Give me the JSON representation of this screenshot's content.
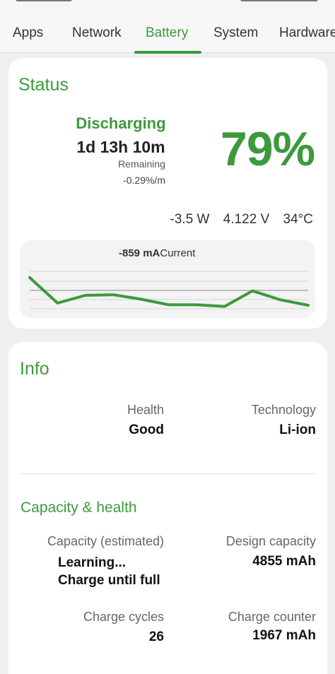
{
  "tabs": [
    {
      "label": "Apps"
    },
    {
      "label": "Network"
    },
    {
      "label": "Battery"
    },
    {
      "label": "System"
    },
    {
      "label": "Hardware"
    }
  ],
  "active_tab": "Battery",
  "status": {
    "title": "Status",
    "state": "Discharging",
    "remaining_time": "1d 13h 10m",
    "remaining_label": "Remaining",
    "rate": "-0.29%/m",
    "percent": "79%",
    "power": "-3.5 W",
    "voltage": "4.122 V",
    "temperature": "34°C",
    "current_value": "-859 mA",
    "current_label": "Current",
    "graph_series": [
      -700,
      -930,
      -860,
      -855,
      -895,
      -945,
      -945,
      -960,
      -820,
      -900,
      -950
    ]
  },
  "info": {
    "title": "Info",
    "health_label": "Health",
    "health_value": "Good",
    "technology_label": "Technology",
    "technology_value": "Li-ion"
  },
  "capacity": {
    "title": "Capacity & health",
    "estimated_label": "Capacity (estimated)",
    "estimated_value_line1": "Learning...",
    "estimated_value_line2": "Charge until full",
    "design_label": "Design capacity",
    "design_value": "4855 mAh",
    "cycles_label": "Charge cycles",
    "cycles_value": "26",
    "counter_label": "Charge counter",
    "counter_value": "1967 mAh"
  },
  "colors": {
    "accent": "#3c9a3c",
    "background": "#efefef",
    "card": "#ffffff"
  }
}
